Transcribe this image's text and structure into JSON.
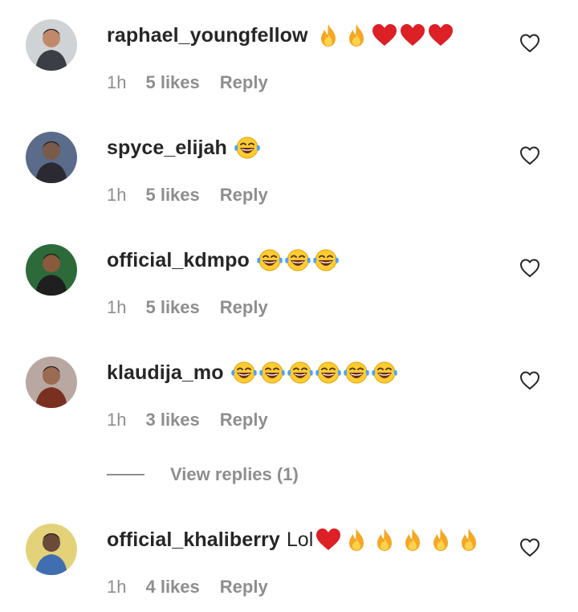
{
  "comments": [
    {
      "username": "raphael_youngfellow",
      "text": "",
      "emojis": [
        "fire",
        "fire",
        "red-heart",
        "red-heart",
        "red-heart"
      ],
      "time": "1h",
      "likes": "5 likes",
      "reply": "Reply",
      "avatar_colors": [
        "#cfd3d6",
        "#3b3f45",
        "#c08a6a"
      ]
    },
    {
      "username": "spyce_elijah",
      "text": "",
      "emojis": [
        "laughing-tears"
      ],
      "time": "1h",
      "likes": "5 likes",
      "reply": "Reply",
      "avatar_colors": [
        "#5b6b8a",
        "#2b2a33",
        "#7a5a48"
      ]
    },
    {
      "username": "official_kdmpo",
      "text": "",
      "emojis": [
        "laughing-tears",
        "laughing-tears",
        "laughing-tears"
      ],
      "time": "1h",
      "likes": "5 likes",
      "reply": "Reply",
      "avatar_colors": [
        "#2d6a3a",
        "#1f1f1f",
        "#8a5a3c"
      ]
    },
    {
      "username": "klaudija_mo",
      "text": "",
      "emojis": [
        "laughing-tears",
        "laughing-tears",
        "laughing-tears",
        "laughing-tears",
        "laughing-tears",
        "laughing-tears"
      ],
      "time": "1h",
      "likes": "3 likes",
      "reply": "Reply",
      "avatar_colors": [
        "#b9a7a1",
        "#7a3020",
        "#9a6a52"
      ]
    },
    {
      "username": "official_khaliberry",
      "text": "Lol",
      "emojis": [
        "red-heart",
        "fire",
        "fire",
        "fire",
        "fire",
        "fire"
      ],
      "time": "1h",
      "likes": "4 likes",
      "reply": "Reply",
      "avatar_colors": [
        "#e4d27a",
        "#3f6fb0",
        "#6b4a3a"
      ]
    }
  ],
  "view_replies": "View replies (1)",
  "colors": {
    "text_primary": "#262626",
    "text_secondary": "#8e8e8e",
    "fire": "#f5a623",
    "heart_red": "#dd1f26",
    "emoji_yellow": "#ffcc33"
  },
  "icons": {
    "like": "heart-outline-icon"
  }
}
